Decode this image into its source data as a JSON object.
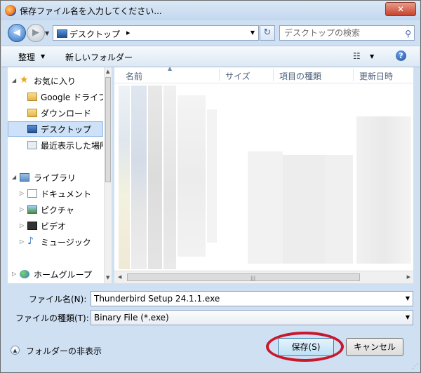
{
  "window": {
    "title": "保存ファイル名を入力してください...",
    "close_label": "✕"
  },
  "address": {
    "location": "デスクトップ",
    "separator": "▸"
  },
  "search": {
    "placeholder": "デスクトップの検索"
  },
  "toolbar": {
    "organize_label": "整理",
    "new_folder_label": "新しいフォルダー",
    "help_label": "?"
  },
  "navigation": {
    "favorites": {
      "label": "お気に入り",
      "items": [
        {
          "label": "Google ドライブ",
          "icon": "google-drive-folder-icon"
        },
        {
          "label": "ダウンロード",
          "icon": "download-folder-icon"
        },
        {
          "label": "デスクトップ",
          "icon": "desktop-icon",
          "selected": true
        },
        {
          "label": "最近表示した場所",
          "icon": "recent-places-icon"
        }
      ]
    },
    "libraries": {
      "label": "ライブラリ",
      "items": [
        {
          "label": "ドキュメント",
          "icon": "documents-icon"
        },
        {
          "label": "ピクチャ",
          "icon": "pictures-icon"
        },
        {
          "label": "ビデオ",
          "icon": "videos-icon"
        },
        {
          "label": "ミュージック",
          "icon": "music-icon"
        }
      ]
    },
    "homegroup": {
      "label": "ホームグループ"
    }
  },
  "file_list": {
    "columns": [
      "名前",
      "サイズ",
      "項目の種類",
      "更新日時"
    ]
  },
  "form": {
    "filename_label": "ファイル名(N):",
    "filename_value": "Thunderbird Setup 24.1.1.exe",
    "filetype_label": "ファイルの種類(T):",
    "filetype_value": "Binary File (*.exe)"
  },
  "footer": {
    "hide_folders_label": "フォルダーの非表示",
    "save_label": "保存(S)",
    "cancel_label": "キャンセル"
  },
  "colors": {
    "frame": "#cfe0f3",
    "selection": "#cde2f8",
    "highlight_ellipse": "#c9182d"
  }
}
